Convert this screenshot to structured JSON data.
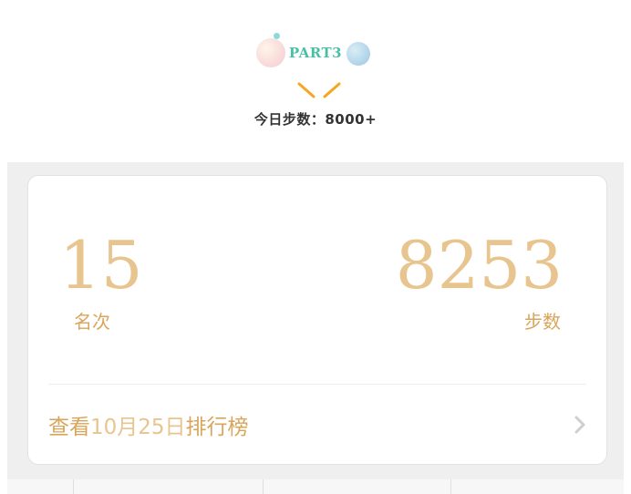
{
  "header": {
    "part_label": "PART3",
    "subtitle": "今日步数：8000+"
  },
  "card": {
    "rank": {
      "value": "15",
      "label": "名次"
    },
    "steps": {
      "value": "8253",
      "label": "步数"
    },
    "leaderboard": {
      "prefix": "查看",
      "date": "10月25日",
      "suffix": "排行榜"
    }
  },
  "colors": {
    "part_label": "#47c0a4",
    "chevron": "#f5a623",
    "value_gold": "#e8c48e",
    "label_gold": "#d9a55a",
    "panel_bg": "#efefef"
  },
  "icons": [
    "bubble-decoration",
    "chevron-down-icon",
    "chevron-right-icon"
  ]
}
